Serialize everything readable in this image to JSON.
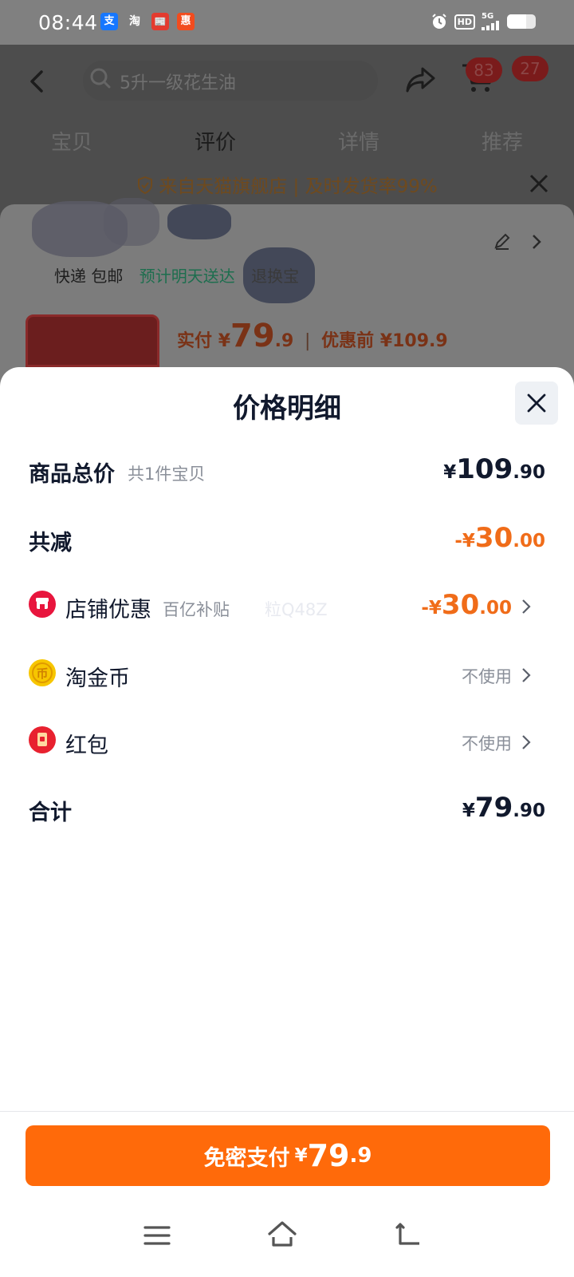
{
  "status_bar": {
    "time": "08:44",
    "apps": [
      "alipay-icon",
      "taobao-icon",
      "news-icon",
      "coupon-icon"
    ],
    "app_glyphs": [
      "支",
      "淘",
      "📰",
      "惠"
    ],
    "app_colors": [
      "#1677ff",
      "#707070",
      "#e33b2f",
      "#f24c1e"
    ],
    "hd": "HD",
    "network": "5G"
  },
  "background_page": {
    "search_placeholder": "5升一级花生油",
    "cart_badge": "83",
    "message_badge": "27",
    "tabs": [
      "宝贝",
      "评价",
      "详情",
      "推荐"
    ],
    "active_tab": "评价",
    "banner": "来自天猫旗舰店 | 及时发货率99%",
    "shipping_label": "快递 包邮",
    "shipping_eta": "预计明天送达",
    "shipping_extra": "退换宝",
    "paid_label": "实付",
    "paid_currency": "¥",
    "paid_int": "79",
    "paid_dec": ".9",
    "separator": "|",
    "original_label": "优惠前",
    "original_price": "¥109.9"
  },
  "sheet": {
    "title": "价格明细",
    "rows": {
      "total": {
        "label": "商品总价",
        "sub": "共1件宝贝",
        "currency": "¥",
        "int": "109",
        "dec": ".90"
      },
      "reduce": {
        "label": "共减",
        "currency": "-¥",
        "int": "30",
        "dec": ".00",
        "color": "#f06c19"
      },
      "shop": {
        "label": "店铺优惠",
        "sub": "百亿补贴",
        "watermark": "粒Q48Z",
        "currency": "-¥",
        "int": "30",
        "dec": ".00",
        "color": "#f06c19"
      },
      "coin": {
        "label": "淘金币",
        "value": "不使用"
      },
      "redpacket": {
        "label": "红包",
        "value": "不使用"
      },
      "sum": {
        "label": "合计",
        "currency": "¥",
        "int": "79",
        "dec": ".90"
      }
    }
  },
  "pay_button": {
    "label": "免密支付",
    "currency": "¥",
    "int": "79",
    "dec": ".9",
    "color": "#ff6a0a"
  },
  "nav": [
    "menu-icon",
    "home-icon",
    "back-icon"
  ]
}
